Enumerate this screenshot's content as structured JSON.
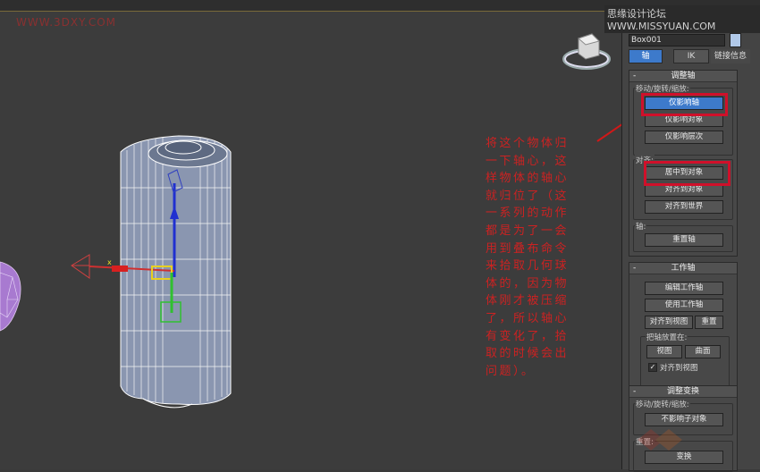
{
  "watermark_left": "WWW.3DXY.COM",
  "watermark_right": "思缘设计论坛 WWW.MISSYUAN.COM",
  "annotation": "将这个物体归一下轴心，这样物体的轴心就归位了（这一系列的动作都是为了一会用到叠布命令来拾取几何球体的，因为物体刚才被压缩了，所以轴心有变化了，拾取的时候会出问题）。",
  "panel": {
    "object_name": "Box001",
    "tabs": [
      "轴",
      "IK",
      "链接信息"
    ],
    "adjust_pivot": {
      "title": "调整轴",
      "move_group_label": "移动/旋转/缩放:",
      "affect_pivot_only": "仅影响轴",
      "affect_object_only": "仅影响对象",
      "affect_hierarchy_only": "仅影响层次",
      "align_group_label": "对齐:",
      "center_to_object": "居中到对象",
      "align_to_object": "对齐到对象",
      "align_to_world": "对齐到世界",
      "pivot_group_label": "轴:",
      "reset_pivot": "重置轴"
    },
    "working_pivot": {
      "title": "工作轴",
      "edit_working_pivot": "编辑工作轴",
      "use_working_pivot": "使用工作轴",
      "align_to_view": "对齐到视图",
      "reset": "重置",
      "place_pivot_label": "把轴放置在:",
      "view": "视图",
      "surface": "曲面",
      "align_to_view_check": "对齐到视图"
    },
    "adjust_transform": {
      "title": "调整变换",
      "move_group_label": "移动/旋转/缩放:",
      "dont_affect_children": "不影响子对象",
      "reset_group_label": "重置:",
      "transform": "变换"
    }
  }
}
